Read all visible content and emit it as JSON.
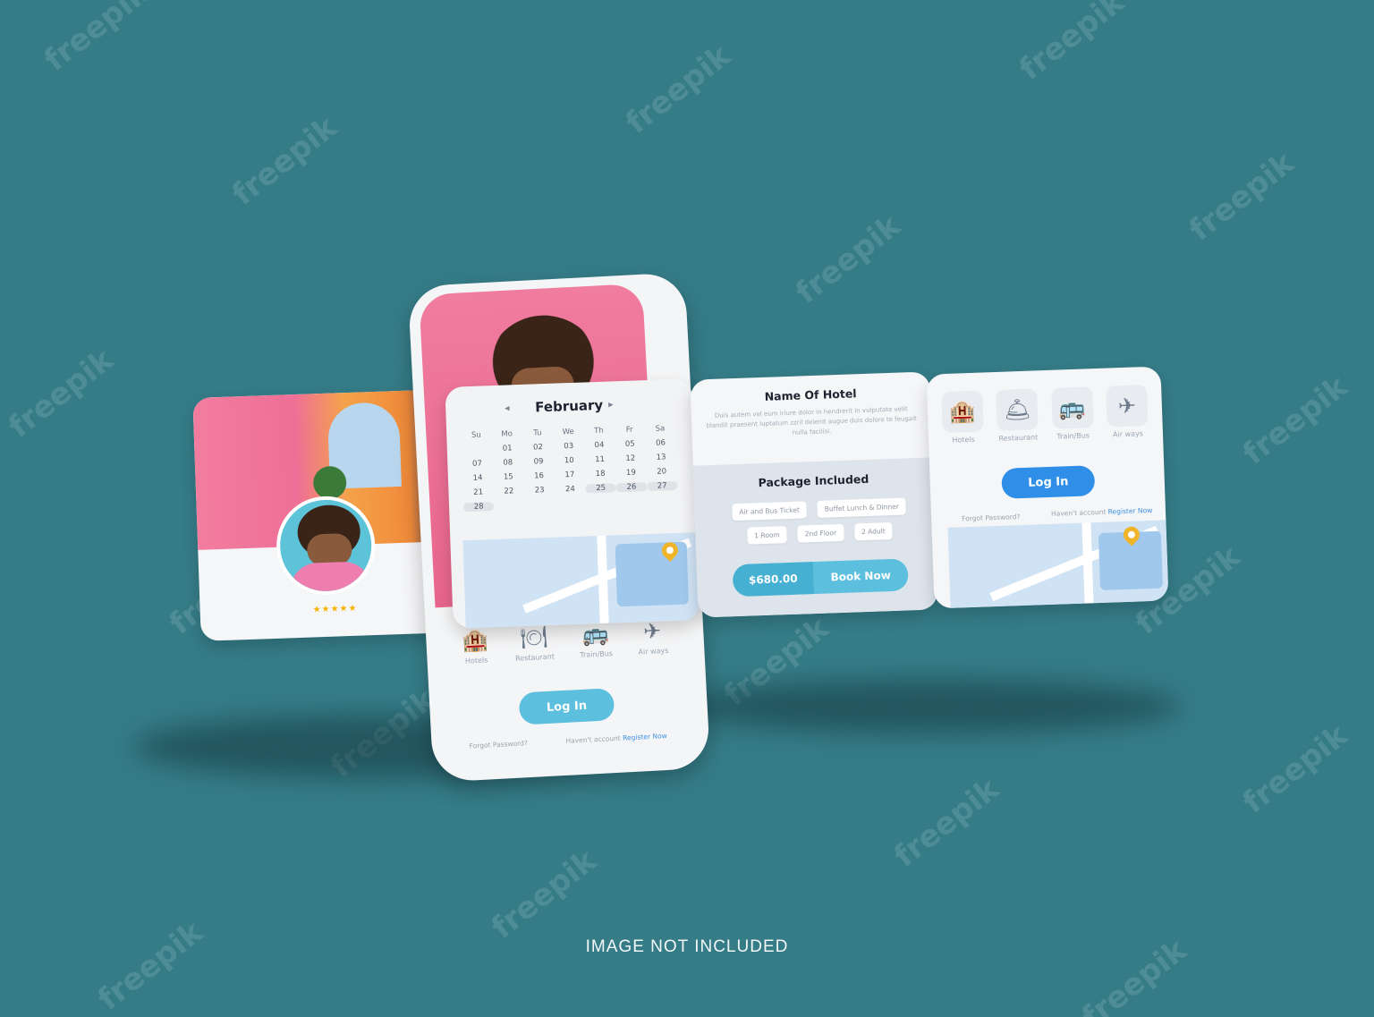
{
  "watermark": "freepik",
  "footer": "IMAGE NOT INCLUDED",
  "profile_card": {
    "rating_stars": 4.5,
    "stars_text": "★★★★★"
  },
  "calendar": {
    "month": "February",
    "prev_glyph": "◀",
    "next_glyph": "▶",
    "weekdays": [
      "Su",
      "Mo",
      "Tu",
      "We",
      "Th",
      "Fr",
      "Sa"
    ],
    "weeks": [
      [
        "",
        "01",
        "02",
        "03",
        "04",
        "05",
        "06"
      ],
      [
        "07",
        "08",
        "09",
        "10",
        "11",
        "12",
        "13"
      ],
      [
        "14",
        "15",
        "16",
        "17",
        "18",
        "19",
        "20"
      ],
      [
        "21",
        "22",
        "23",
        "24",
        "25",
        "26",
        "27"
      ],
      [
        "28",
        "",
        "",
        "",
        "",
        "",
        ""
      ]
    ],
    "highlighted": [
      "25",
      "26",
      "27",
      "28"
    ]
  },
  "phone": {
    "categories": [
      {
        "label": "Hotels",
        "icon": "hotel-icon",
        "glyph": "🏨"
      },
      {
        "label": "Restaurant",
        "icon": "restaurant-icon",
        "glyph": "🍽"
      },
      {
        "label": "Train/Bus",
        "icon": "bus-icon",
        "glyph": "🚌"
      },
      {
        "label": "Air ways",
        "icon": "airplane-icon",
        "glyph": "✈"
      }
    ],
    "login_label": "Log In",
    "forgot": "Forgot Password?",
    "havent": "Haven't account",
    "register": "Register Now"
  },
  "hotel_card": {
    "title": "Name Of Hotel",
    "description": "Duis autem vel eum iriure dolor in hendrerit in vulputate velit blandit praesent luptatum zzril delenit augue duis dolore te feugait nulla facilisi.",
    "package_title": "Package Included",
    "chips": [
      "Air and Bus Ticket",
      "Buffet Lunch & Dinner",
      "1 Room",
      "2nd Floor",
      "2 Adult"
    ],
    "price": "$680.00",
    "book_label": "Book Now"
  },
  "login_card": {
    "categories": [
      {
        "label": "Hotels",
        "icon": "hotel-icon",
        "glyph": "🏨"
      },
      {
        "label": "Restaurant",
        "icon": "restaurant-icon",
        "glyph": "🛎"
      },
      {
        "label": "Train/Bus",
        "icon": "bus-icon",
        "glyph": "🚌"
      },
      {
        "label": "Air ways",
        "icon": "airplane-icon",
        "glyph": "✈"
      }
    ],
    "login_label": "Log In",
    "forgot": "Forgot Password?",
    "havent": "Haven't account",
    "register": "Register Now"
  },
  "colors": {
    "background": "#357c87",
    "accent_blue": "#2f8fe8",
    "accent_teal": "#5bbfdd",
    "pink": "#ee6f98"
  }
}
